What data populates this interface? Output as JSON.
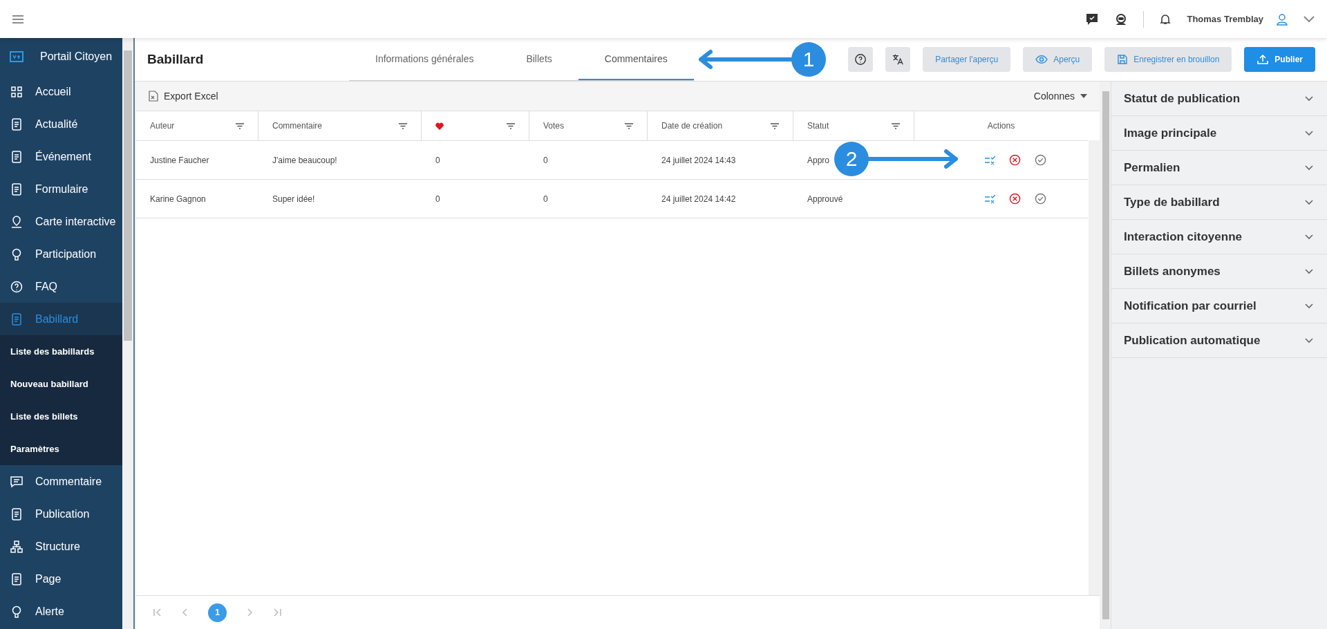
{
  "top_bar": {
    "user_name": "Thomas Tremblay"
  },
  "sidebar": {
    "items": [
      {
        "label": "Portail Citoyen",
        "kind": "brand",
        "selected": false
      },
      {
        "label": "Accueil",
        "kind": "item",
        "selected": false
      },
      {
        "label": "Actualité",
        "kind": "item",
        "selected": false
      },
      {
        "label": "Événement",
        "kind": "item",
        "selected": false
      },
      {
        "label": "Formulaire",
        "kind": "item",
        "selected": false
      },
      {
        "label": "Carte interactive",
        "kind": "item",
        "selected": false
      },
      {
        "label": "Participation",
        "kind": "item",
        "selected": false
      },
      {
        "label": "FAQ",
        "kind": "item",
        "selected": false
      },
      {
        "label": "Babillard",
        "kind": "item",
        "selected": true,
        "expanded": true,
        "children": [
          {
            "label": "Liste des babillards"
          },
          {
            "label": "Nouveau babillard"
          },
          {
            "label": "Liste des billets"
          },
          {
            "label": "Paramètres"
          }
        ]
      },
      {
        "label": "Commentaire",
        "kind": "item",
        "selected": false
      },
      {
        "label": "Publication",
        "kind": "item",
        "selected": false
      },
      {
        "label": "Structure",
        "kind": "item",
        "selected": false
      },
      {
        "label": "Page",
        "kind": "item",
        "selected": false
      },
      {
        "label": "Alerte",
        "kind": "item",
        "selected": false
      }
    ]
  },
  "header": {
    "title": "Babillard",
    "tabs": [
      {
        "label": "Informations générales",
        "selected": false
      },
      {
        "label": "Billets",
        "selected": false
      },
      {
        "label": "Commentaires",
        "selected": true
      }
    ],
    "buttons": [
      {
        "label": "Partager l'aperçu",
        "kind": "plain"
      },
      {
        "label": "Aperçu",
        "kind": "eye"
      },
      {
        "label": "Enregistrer en brouillon",
        "kind": "save"
      },
      {
        "label": "Publier",
        "kind": "primary"
      }
    ]
  },
  "toolbar": {
    "export": "Export Excel",
    "columns": "Colonnes"
  },
  "table": {
    "columns": [
      {
        "label": "Auteur",
        "filter": true
      },
      {
        "label": "Commentaire",
        "filter": true
      },
      {
        "kind": "heart",
        "filter": true
      },
      {
        "label": "Votes",
        "filter": true
      },
      {
        "label": "Date de création",
        "filter": true
      },
      {
        "label": "Statut",
        "filter": true
      },
      {
        "label": "Actions",
        "filter": false
      }
    ],
    "rows": [
      {
        "cells": [
          "Justine Faucher",
          "J'aime beaucoup!",
          "0",
          "0",
          "24 juillet 2024 14:43",
          "Appro"
        ]
      },
      {
        "cells": [
          "Karine Gagnon",
          "Super idée!",
          "0",
          "0",
          "24 juillet 2024 14:42",
          "Approuvé"
        ]
      }
    ]
  },
  "pagination": {
    "pages": [
      {
        "label": "1",
        "selected": true
      }
    ]
  },
  "right_panel": {
    "sections": [
      {
        "label": "Statut de publication",
        "expanded": false
      },
      {
        "label": "Image principale",
        "expanded": false
      },
      {
        "label": "Permalien",
        "expanded": false
      },
      {
        "label": "Type de babillard",
        "expanded": false
      },
      {
        "label": "Interaction citoyenne",
        "expanded": false
      },
      {
        "label": "Billets anonymes",
        "expanded": false
      },
      {
        "label": "Notification par courriel",
        "expanded": false
      },
      {
        "label": "Publication automatique",
        "expanded": false
      }
    ]
  },
  "annotations": [
    {
      "label": "1"
    },
    {
      "label": "2"
    }
  ]
}
